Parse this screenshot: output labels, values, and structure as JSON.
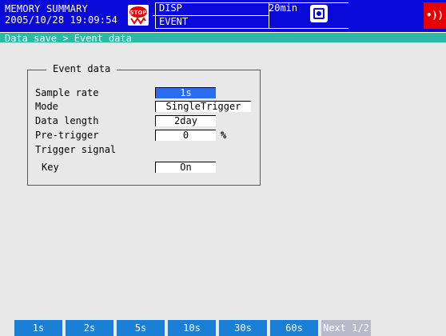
{
  "status": {
    "mode_line1": "MEMORY SUMMARY",
    "datetime": "2005/10/28 19:09:54",
    "stop_icon_text": "STOP",
    "disp_label": "DISP",
    "event_label": "EVENT",
    "interval": "20min",
    "media_icon": "media-disk-icon",
    "alarm_icon": "alarm-wave-icon"
  },
  "breadcrumb": "Data save > Event data",
  "panel": {
    "title": "Event data",
    "rows": [
      {
        "label": "Sample rate",
        "value": "1s"
      },
      {
        "label": "Mode",
        "value": "SingleTrigger"
      },
      {
        "label": "Data length",
        "value": "2day"
      },
      {
        "label": "Pre-trigger",
        "value": "0",
        "unit": "%"
      },
      {
        "label": "Trigger signal"
      },
      {
        "label": "Key",
        "value": "On"
      }
    ]
  },
  "softkeys": [
    "1s",
    "2s",
    "5s",
    "10s",
    "30s",
    "60s",
    "Next 1/2"
  ],
  "colors": {
    "status_bar": "#0a0ad8",
    "breadcrumb_bar": "#2bb9a6",
    "selected_field": "#2a6cf0",
    "softkey": "#1c7fd6",
    "alarm": "#e60000"
  }
}
